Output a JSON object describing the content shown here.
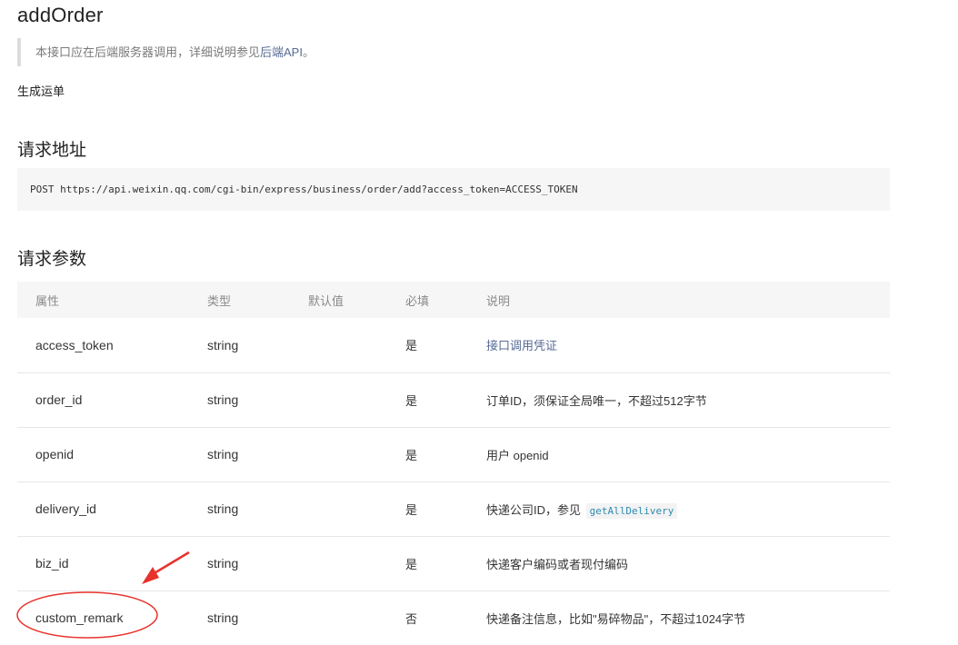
{
  "header": {
    "title": "addOrder",
    "note_prefix": "本接口应在后端服务器调用，详细说明参见",
    "note_link": "后端API",
    "note_suffix": "。",
    "description": "生成运单"
  },
  "request_url": {
    "heading": "请求地址",
    "code": "POST https://api.weixin.qq.com/cgi-bin/express/business/order/add?access_token=ACCESS_TOKEN"
  },
  "params": {
    "heading": "请求参数",
    "columns": [
      "属性",
      "类型",
      "默认值",
      "必填",
      "说明"
    ],
    "rows": [
      {
        "name": "access_token",
        "type": "string",
        "default": "",
        "required": "是",
        "desc_link": "接口调用凭证"
      },
      {
        "name": "order_id",
        "type": "string",
        "default": "",
        "required": "是",
        "desc": "订单ID，须保证全局唯一，不超过512字节"
      },
      {
        "name": "openid",
        "type": "string",
        "default": "",
        "required": "是",
        "desc": "用户 openid"
      },
      {
        "name": "delivery_id",
        "type": "string",
        "default": "",
        "required": "是",
        "desc": "快递公司ID，参见",
        "desc_code": "getAllDelivery"
      },
      {
        "name": "biz_id",
        "type": "string",
        "default": "",
        "required": "是",
        "desc": "快递客户编码或者现付编码"
      },
      {
        "name": "custom_remark",
        "type": "string",
        "default": "",
        "required": "否",
        "desc": "快递备注信息，比如\"易碎物品\"，不超过1024字节"
      }
    ]
  },
  "annotation": {
    "color": "#e8322c"
  }
}
